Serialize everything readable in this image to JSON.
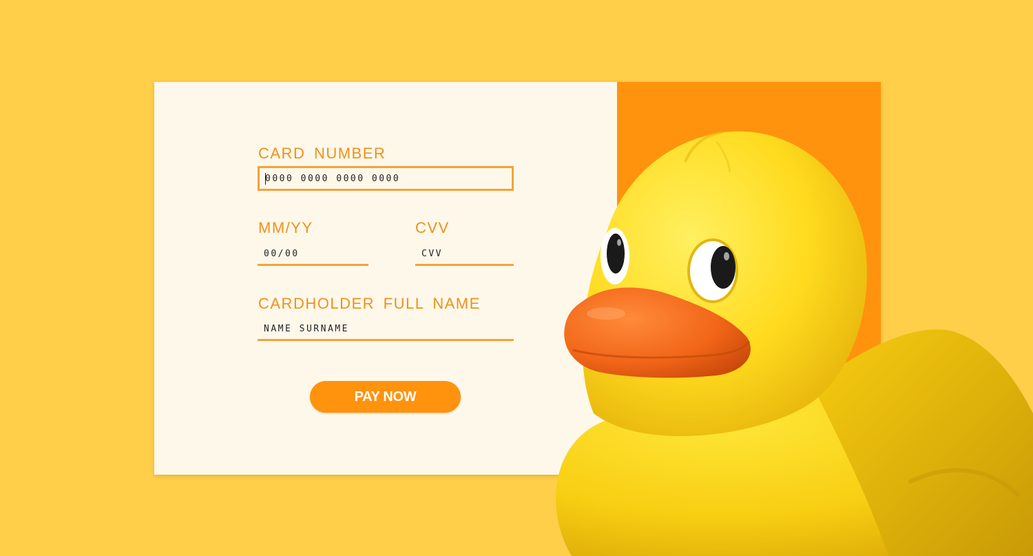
{
  "form": {
    "card_number": {
      "label": "CARD NUMBER",
      "value": "0000 0000 0000 0000"
    },
    "expiry": {
      "label": "MM/YY",
      "value": "00/00"
    },
    "cvv": {
      "label": "CVV",
      "value": "CVV"
    },
    "cardholder": {
      "label": "CARDHOLDER FULL NAME",
      "value": "NAME SURNAME"
    },
    "pay_button": "PAY NOW"
  },
  "illustration": {
    "icon": "rubber-duck-icon"
  },
  "colors": {
    "background": "#FFCF4A",
    "form_panel": "#FEF8EA",
    "accent": "#FF930D",
    "label_text": "#F0901A",
    "field_line": "#F3A23A",
    "duck_body": "#FFD71E",
    "duck_beak": "#F06A14"
  }
}
